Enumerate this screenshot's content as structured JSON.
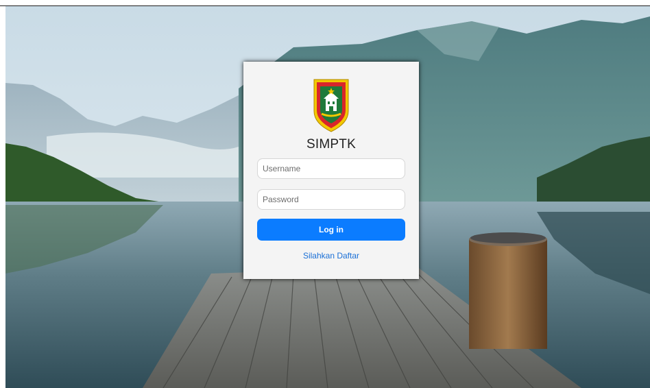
{
  "app": {
    "title": "SIMPTK",
    "logo": "regional-government-crest"
  },
  "login": {
    "username_placeholder": "Username",
    "password_placeholder": "Password",
    "username_value": "",
    "password_value": "",
    "login_label": "Log in",
    "register_label": "Silahkan Daftar"
  },
  "colors": {
    "button": "#0b7cff",
    "link": "#1a6fd6",
    "card": "#f4f4f4"
  }
}
